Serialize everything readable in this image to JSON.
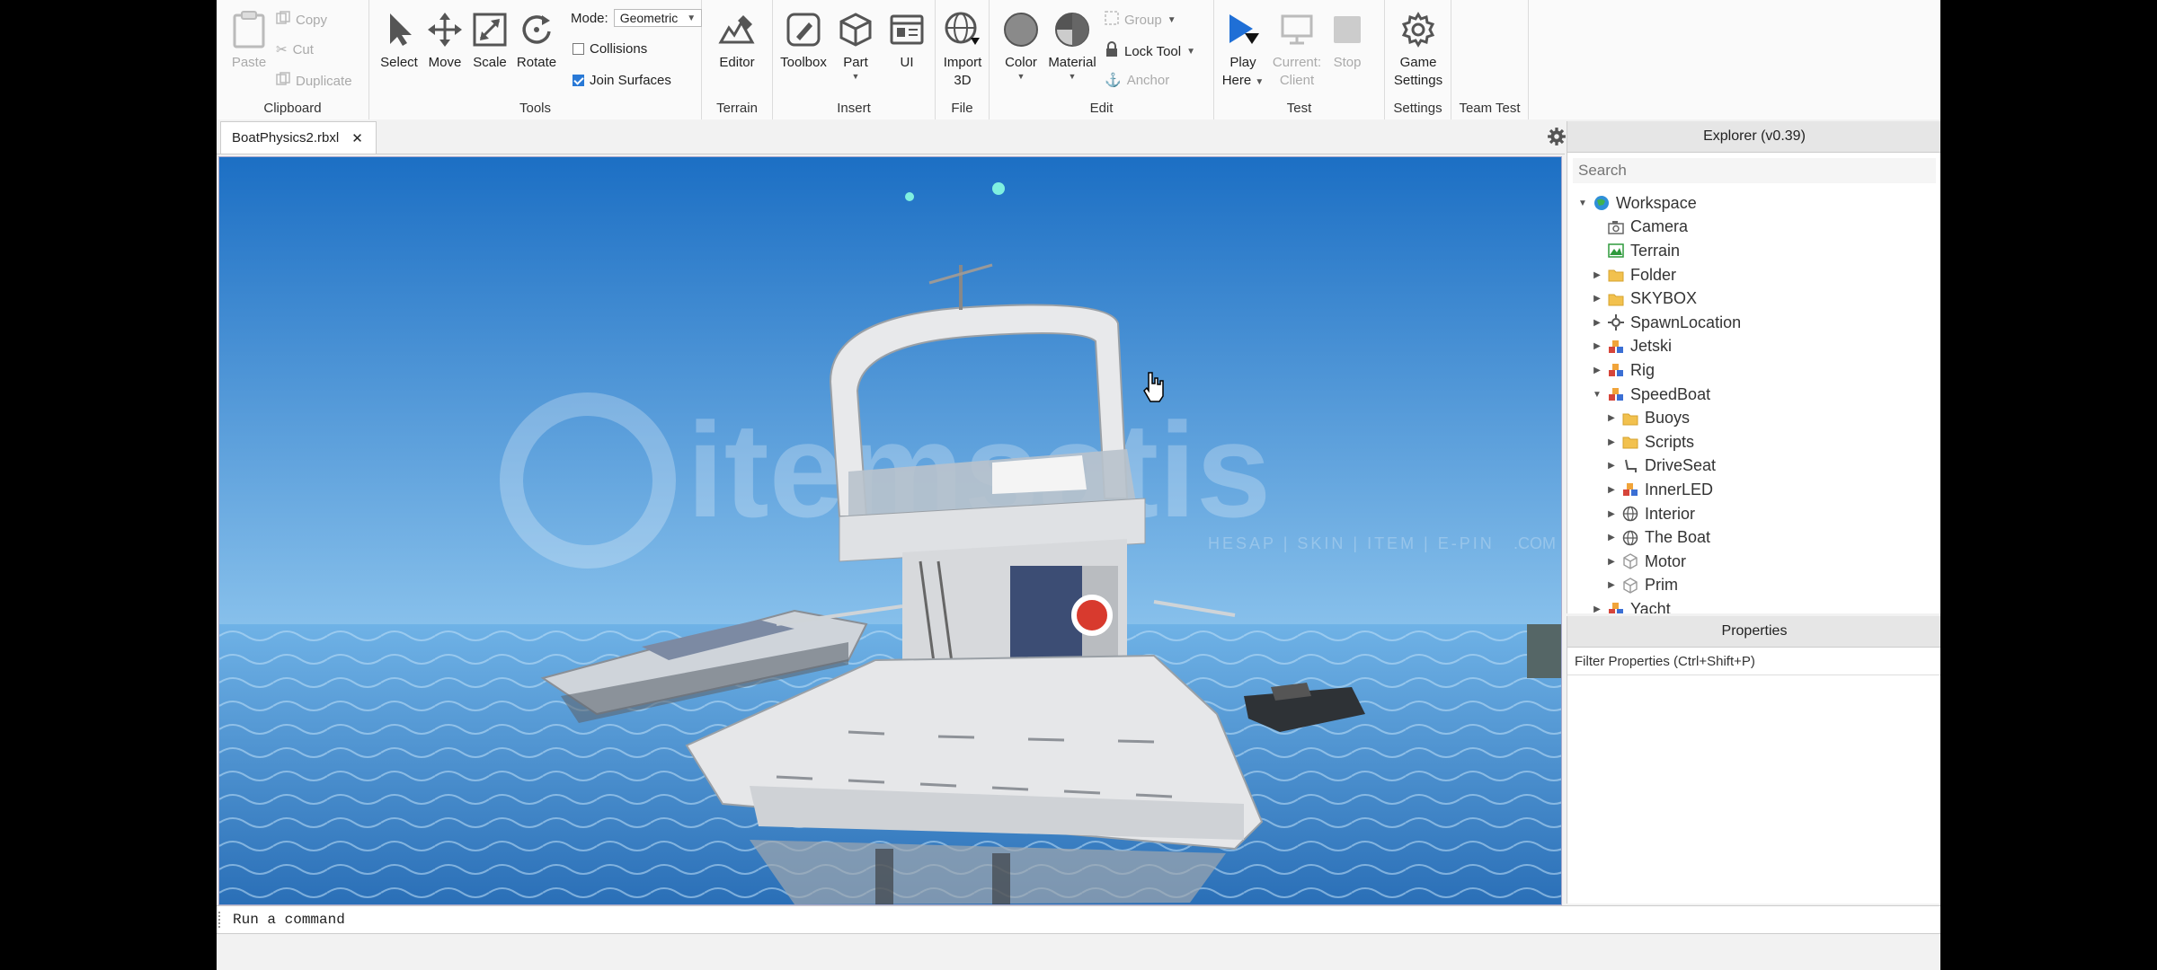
{
  "ribbon": {
    "clipboard": {
      "paste": "Paste",
      "copy": "Copy",
      "cut": "Cut",
      "duplicate": "Duplicate",
      "group_label": "Clipboard"
    },
    "tools": {
      "select": "Select",
      "move": "Move",
      "scale": "Scale",
      "rotate": "Rotate",
      "mode_label": "Mode:",
      "mode_value": "Geometric",
      "collisions": "Collisions",
      "collisions_checked": false,
      "join_surfaces": "Join Surfaces",
      "join_surfaces_checked": true,
      "group_label": "Tools"
    },
    "terrain": {
      "editor": "Editor",
      "group_label": "Terrain"
    },
    "insert": {
      "toolbox": "Toolbox",
      "part": "Part",
      "ui": "UI",
      "group_label": "Insert"
    },
    "file": {
      "import_line1": "Import",
      "import_line2": "3D",
      "group_label": "File"
    },
    "edit": {
      "color": "Color",
      "material": "Material",
      "group": "Group",
      "lock_tool": "Lock Tool",
      "anchor": "Anchor",
      "group_label": "Edit"
    },
    "test": {
      "play_line1": "Play",
      "play_line2": "Here",
      "current_line1": "Current:",
      "current_line2": "Client",
      "stop": "Stop",
      "group_label": "Test"
    },
    "settings": {
      "game_line1": "Game",
      "game_line2": "Settings",
      "group_label": "Settings"
    },
    "team_test": {
      "group_label": "Team Test"
    }
  },
  "document_tab": {
    "title": "BoatPhysics2.rbxl",
    "close": "✕"
  },
  "viewport": {
    "watermark": "itemsatis",
    "watermark_sub": "HESAP | SKIN | ITEM | E-PIN",
    "watermark_suffix": ".COM",
    "colors": {
      "sky_top": "#1c6fc4",
      "sky_horizon": "#8fc6ee",
      "sea": "#2a6fb7"
    }
  },
  "explorer": {
    "title": "Explorer (v0.39)",
    "search_placeholder": "Search",
    "items": [
      {
        "label": "Workspace",
        "level": 0,
        "arrow": "▼",
        "icon": "globe-icon"
      },
      {
        "label": "Camera",
        "level": 1,
        "arrow": "",
        "icon": "camera-icon"
      },
      {
        "label": "Terrain",
        "level": 1,
        "arrow": "",
        "icon": "terrain-icon"
      },
      {
        "label": "Folder",
        "level": 1,
        "arrow": "▶",
        "icon": "folder-icon"
      },
      {
        "label": "SKYBOX",
        "level": 1,
        "arrow": "▶",
        "icon": "folder-icon"
      },
      {
        "label": "SpawnLocation",
        "level": 1,
        "arrow": "▶",
        "icon": "spawn-icon"
      },
      {
        "label": "Jetski",
        "level": 1,
        "arrow": "▶",
        "icon": "model-icon"
      },
      {
        "label": "Rig",
        "level": 1,
        "arrow": "▶",
        "icon": "model-icon"
      },
      {
        "label": "SpeedBoat",
        "level": 1,
        "arrow": "▼",
        "icon": "model-icon"
      },
      {
        "label": "Buoys",
        "level": 2,
        "arrow": "▶",
        "icon": "folder-icon"
      },
      {
        "label": "Scripts",
        "level": 2,
        "arrow": "▶",
        "icon": "folder-icon"
      },
      {
        "label": "DriveSeat",
        "level": 2,
        "arrow": "▶",
        "icon": "seat-icon"
      },
      {
        "label": "InnerLED",
        "level": 2,
        "arrow": "▶",
        "icon": "model-icon"
      },
      {
        "label": "Interior",
        "level": 2,
        "arrow": "▶",
        "icon": "mesh-globe-icon"
      },
      {
        "label": "The Boat",
        "level": 2,
        "arrow": "▶",
        "icon": "mesh-globe-icon"
      },
      {
        "label": "Motor",
        "level": 2,
        "arrow": "▶",
        "icon": "part-icon"
      },
      {
        "label": "Prim",
        "level": 2,
        "arrow": "▶",
        "icon": "part-icon"
      },
      {
        "label": "Yacht",
        "level": 1,
        "arrow": "▶",
        "icon": "model-icon"
      }
    ]
  },
  "properties": {
    "title": "Properties",
    "filter_placeholder": "Filter Properties (Ctrl+Shift+P)"
  },
  "command_bar": {
    "placeholder": "Run a command"
  }
}
